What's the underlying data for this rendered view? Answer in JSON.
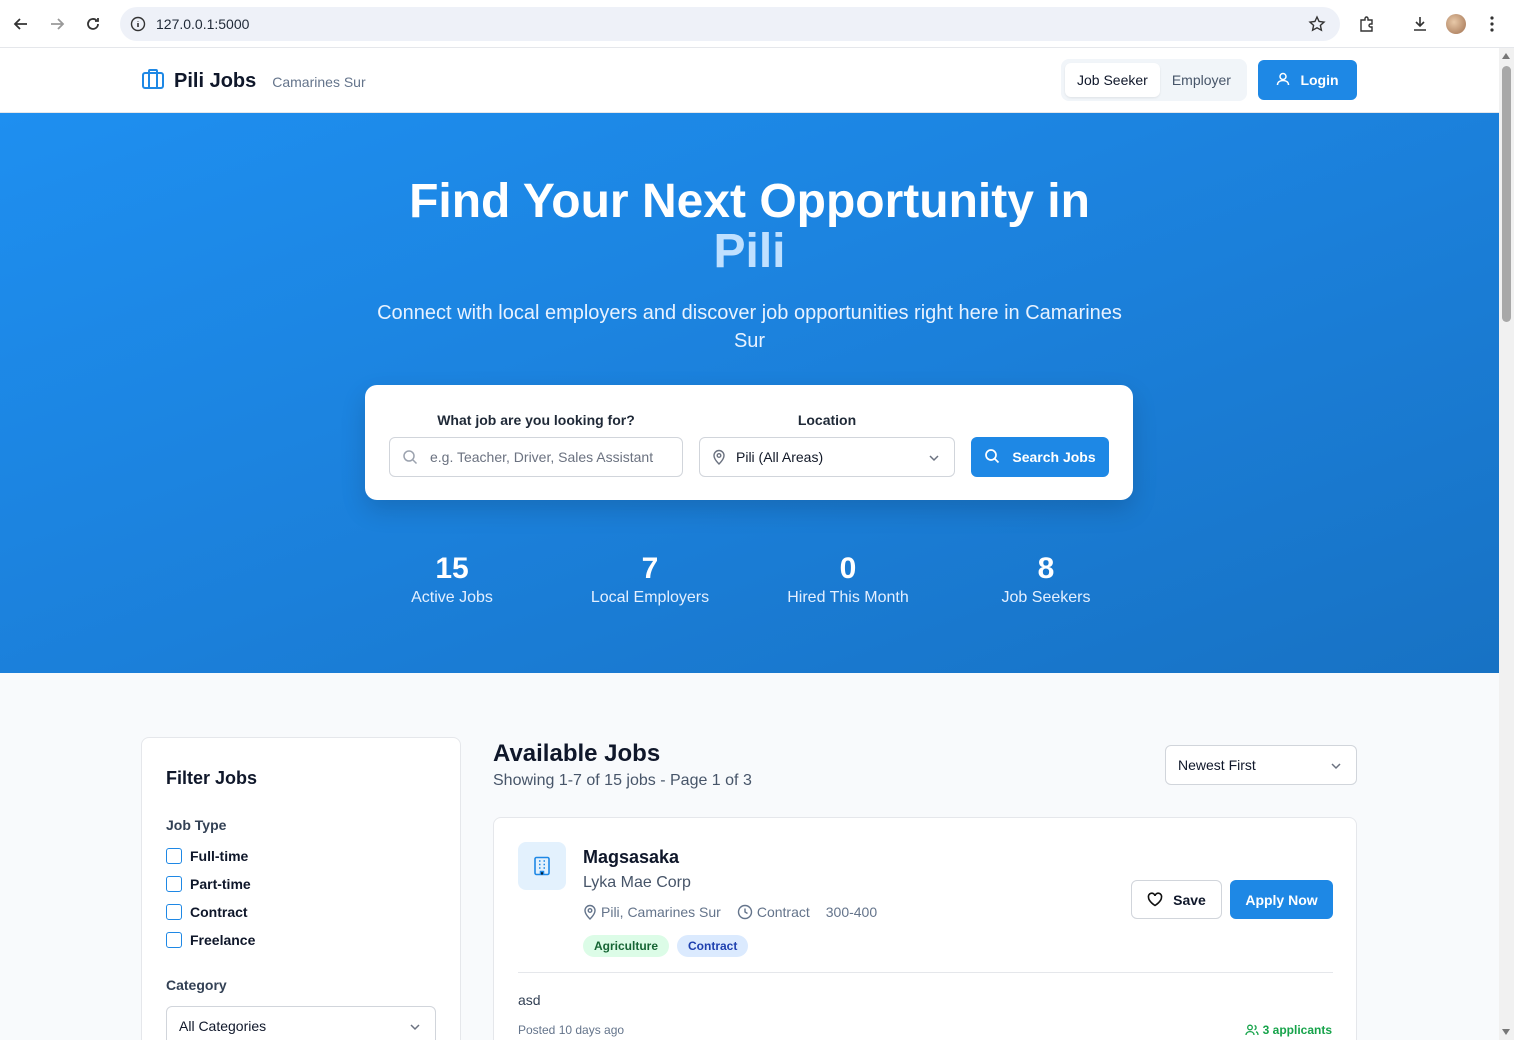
{
  "browser": {
    "url": "127.0.0.1:5000"
  },
  "header": {
    "brand": "Pili Jobs",
    "location": "Camarines Sur",
    "roles": [
      "Job Seeker",
      "Employer"
    ],
    "active_role": "Job Seeker",
    "login_label": "Login"
  },
  "hero": {
    "title_line1": "Find Your Next Opportunity in",
    "title_highlight": "Pili",
    "subtitle": "Connect with local employers and discover job opportunities right here in Camarines Sur",
    "search": {
      "query_label": "What job are you looking for?",
      "query_placeholder": "e.g. Teacher, Driver, Sales Assistant",
      "location_label": "Location",
      "location_value": "Pili (All Areas)",
      "button_label": "Search Jobs"
    },
    "stats": [
      {
        "value": "15",
        "label": "Active Jobs"
      },
      {
        "value": "7",
        "label": "Local Employers"
      },
      {
        "value": "0",
        "label": "Hired This Month"
      },
      {
        "value": "8",
        "label": "Job Seekers"
      }
    ]
  },
  "filters": {
    "title": "Filter Jobs",
    "job_type_label": "Job Type",
    "job_types": [
      "Full-time",
      "Part-time",
      "Contract",
      "Freelance"
    ],
    "category_label": "Category",
    "category_value": "All Categories"
  },
  "jobs": {
    "title": "Available Jobs",
    "summary": "Showing 1-7 of 15 jobs - Page 1 of 3",
    "sort_value": "Newest First",
    "items": [
      {
        "title": "Magsasaka",
        "company": "Lyka Mae Corp",
        "location": "Pili, Camarines Sur",
        "type": "Contract",
        "salary": "300-400",
        "tags": [
          "Agriculture",
          "Contract"
        ],
        "description": "asd",
        "posted": "Posted 10 days ago",
        "applicants": "3 applicants",
        "save_label": "Save",
        "apply_label": "Apply Now"
      }
    ]
  },
  "colors": {
    "primary": "#1e88e5",
    "hero_highlight": "#bfe0ff",
    "tag_green": "#dcfce7",
    "tag_blue": "#dbeafe"
  }
}
